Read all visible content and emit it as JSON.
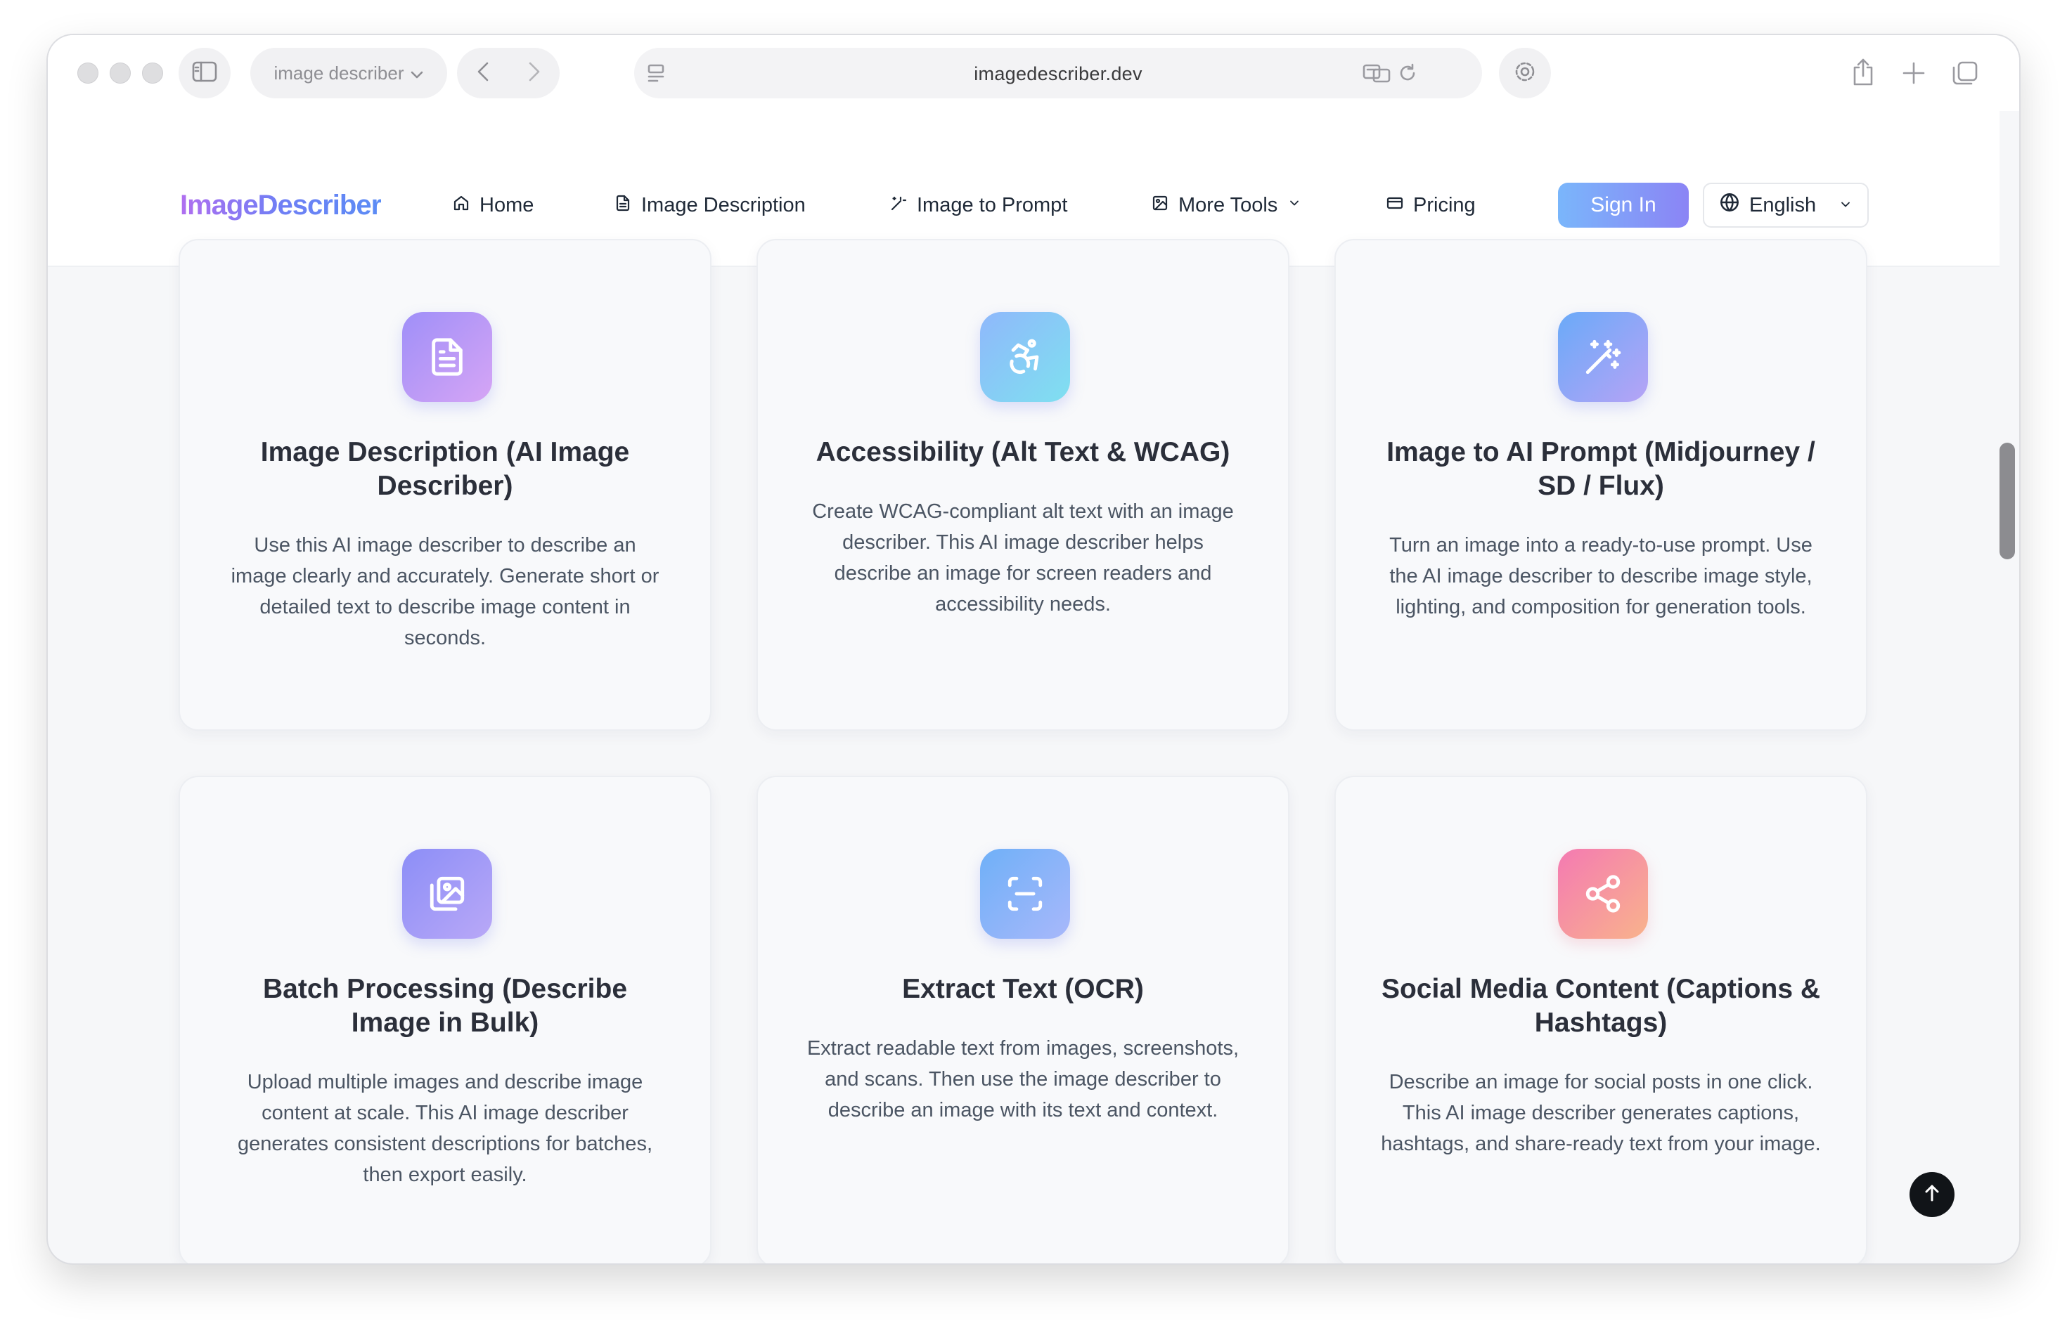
{
  "browser": {
    "tab_group_label": "image describer",
    "url": "imagedescriber.dev"
  },
  "header": {
    "logo": "ImageDescriber",
    "nav": [
      {
        "label": "Home",
        "icon": "home-icon"
      },
      {
        "label": "Image Description",
        "icon": "document-icon"
      },
      {
        "label": "Image to Prompt",
        "icon": "magic-wand-icon"
      },
      {
        "label": "More Tools",
        "icon": "image-icon"
      },
      {
        "label": "Pricing",
        "icon": "credit-card-icon"
      }
    ],
    "signin_label": "Sign In",
    "language": "English"
  },
  "cards": [
    {
      "title": "Image Description (AI Image Describer)",
      "description": "Use this AI image describer to describe an image clearly and accurately. Generate short or detailed text to describe image content in seconds.",
      "icon": "document-icon",
      "gradient": [
        "#a78bfa",
        "#c4a6f7"
      ]
    },
    {
      "title": "Accessibility (Alt Text & WCAG)",
      "description": "Create WCAG-compliant alt text with an image describer. This AI image describer helps describe an image for screen readers and accessibility needs.",
      "icon": "accessibility-icon",
      "gradient": [
        "#7dd3fc",
        "#93c5fd"
      ]
    },
    {
      "title": "Image to AI Prompt (Midjourney / SD / Flux)",
      "description": "Turn an image into a ready-to-use prompt. Use the AI image describer to describe image style, lighting, and composition for generation tools.",
      "icon": "magic-wand-icon",
      "gradient": [
        "#60a5fa",
        "#a5b4fc"
      ]
    },
    {
      "title": "Batch Processing (Describe Image in Bulk)",
      "description": "Upload multiple images and describe image content at scale. This AI image describer generates consistent descriptions for batches, then export easily.",
      "icon": "images-stack-icon",
      "gradient": [
        "#818cf8",
        "#a5b4fc"
      ]
    },
    {
      "title": "Extract Text (OCR)",
      "description": "Extract readable text from images, screenshots, and scans. Then use the image describer to describe an image with its text and context.",
      "icon": "scan-icon",
      "gradient": [
        "#60a5fa",
        "#93c5fd"
      ]
    },
    {
      "title": "Social Media Content (Captions & Hashtags)",
      "description": "Describe an image for social posts in one click. This AI image describer generates captions, hashtags, and share-ready text from your image.",
      "icon": "share-icon",
      "gradient": [
        "#f472b6",
        "#fdba74"
      ]
    }
  ]
}
